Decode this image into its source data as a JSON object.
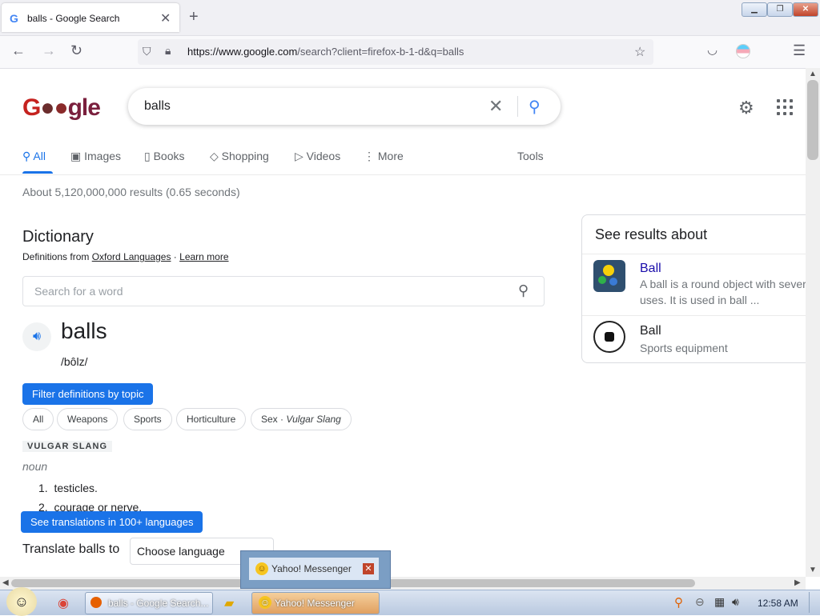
{
  "browser": {
    "tab_title": "balls - Google Search",
    "tab_favicon": "G",
    "url_host": "https://www.google.com",
    "url_path": "/search?client=firefox-b-1-d&q=balls"
  },
  "google": {
    "logo_text": "Google",
    "query": "balls",
    "tabs": [
      {
        "label": "All",
        "icon": "search-icon"
      },
      {
        "label": "Images",
        "icon": "image-icon"
      },
      {
        "label": "Books",
        "icon": "book-icon"
      },
      {
        "label": "Shopping",
        "icon": "tag-icon"
      },
      {
        "label": "Videos",
        "icon": "play-icon"
      },
      {
        "label": "More",
        "icon": "more-icon"
      }
    ],
    "tools_label": "Tools",
    "stats": "About 5,120,000,000 results (0.65 seconds)"
  },
  "dictionary": {
    "title": "Dictionary",
    "source_prefix": "Definitions from",
    "source_link": "Oxford Languages",
    "separator": " · ",
    "learn_more": "Learn more",
    "search_placeholder": "Search for a word",
    "word": "balls",
    "phonetic": "/bôlz/",
    "filter_label": "Filter definitions by topic",
    "chips": [
      "All",
      "Weapons",
      "Sports",
      "Horticulture",
      "Sex · "
    ],
    "chip_sex_italic": "Vulgar Slang",
    "sense_label": "VULGAR SLANG",
    "part_of_speech": "noun",
    "definitions": [
      {
        "num": "1.",
        "text": "testicles."
      },
      {
        "num": "2.",
        "text": "courage or nerve."
      }
    ],
    "translate_button": "See translations in 100+ languages",
    "translate_label": "Translate balls to",
    "language_select": "Choose language"
  },
  "knowledge_panel": {
    "title": "See results about",
    "items": [
      {
        "name": "Ball",
        "desc": "A ball is a round object with sever uses. It is used in ball ..."
      },
      {
        "name": "Ball",
        "desc": "Sports equipment"
      }
    ]
  },
  "notification": {
    "label": "Yahoo! Messenger"
  },
  "taskbar": {
    "items": [
      {
        "label": "balls - Google Search..."
      },
      {
        "label": "Yahoo! Messenger"
      }
    ],
    "clock": "12:58 AM"
  },
  "colors": {
    "accent": "#1a73e8",
    "link": "#1a0dab"
  }
}
